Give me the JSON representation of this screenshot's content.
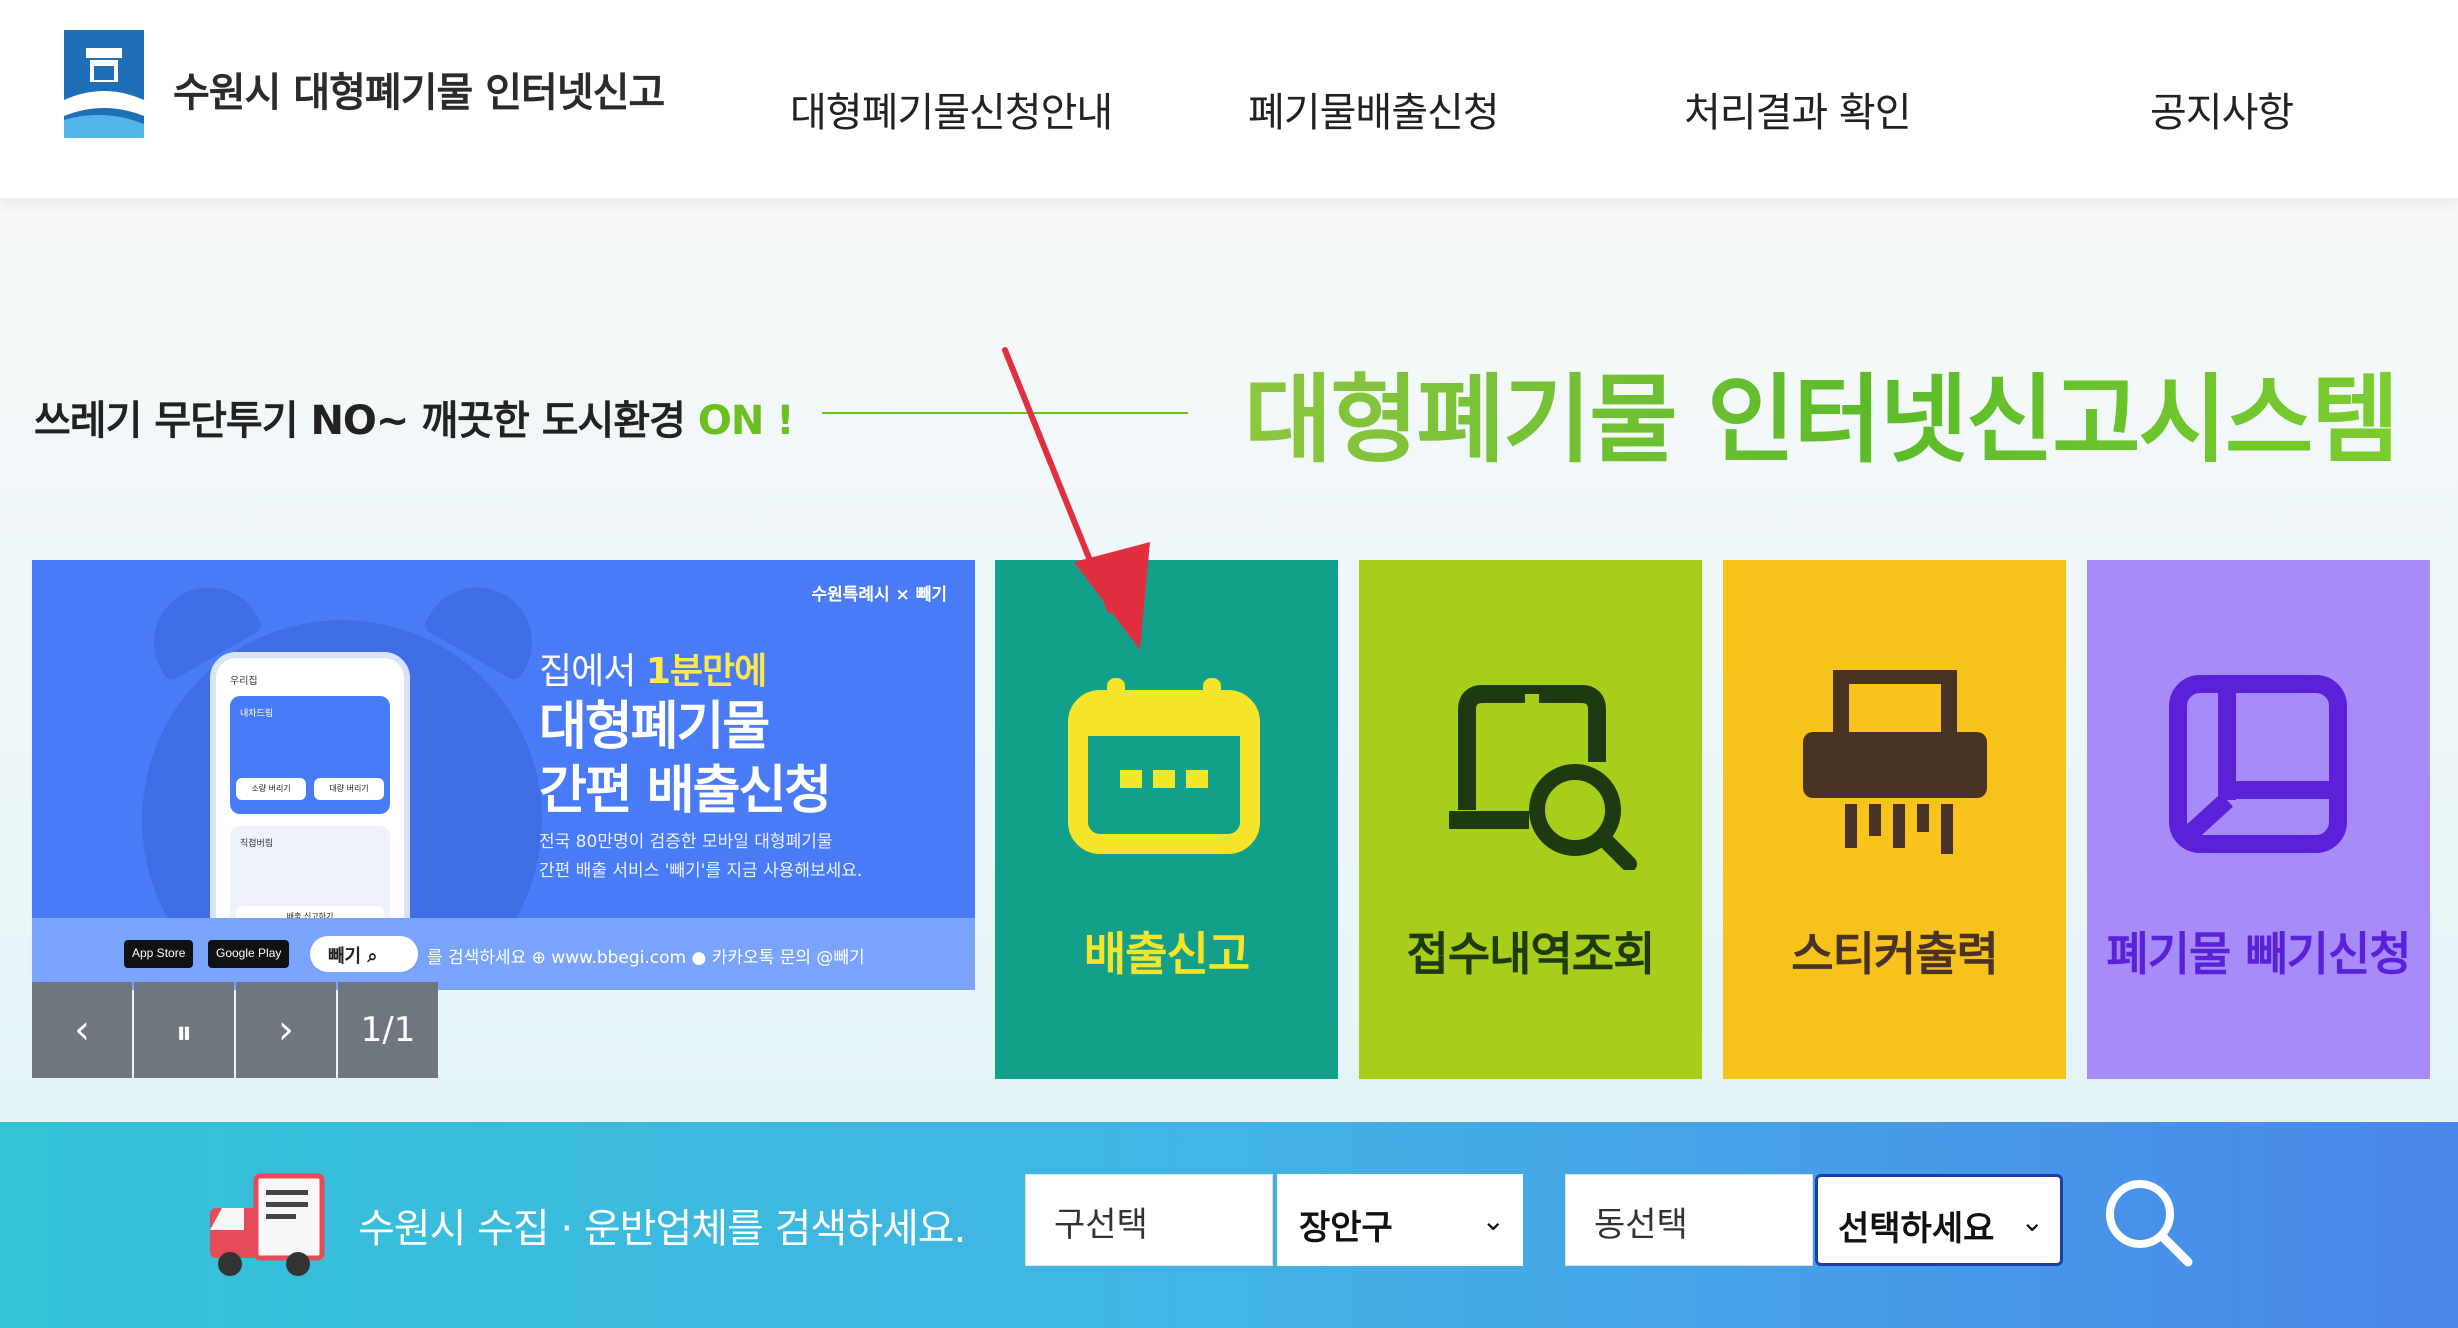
{
  "header": {
    "site_title": "수원시 대형폐기물 인터넷신고",
    "nav": [
      {
        "label": "대형폐기물신청안내"
      },
      {
        "label": "폐기물배출신청"
      },
      {
        "label": "처리결과 확인"
      },
      {
        "label": "공지사항"
      }
    ]
  },
  "hero": {
    "slogan_main": "쓰레기 무단투기 NO~ 깨끗한 도시환경 ",
    "slogan_on": "ON !",
    "big_title": "대형폐기물 인터넷신고시스템"
  },
  "banner": {
    "brand": "수원특례시 × 빼기",
    "sub_pre": "집에서 ",
    "sub_highlight": "1분만에",
    "headline_1": "대형폐기물",
    "headline_2": "간편 배출신청",
    "desc_1": "전국 80만명이 검증한 모바일 대형폐기물",
    "desc_2": "간편 배출 서비스 '빼기'를 지금 사용해보세요.",
    "app_store": "App Store",
    "google_play": "Google Play",
    "search_pill": "빼기",
    "links": "를 검색하세요   ⊕ www.bbegi.com   ● 카카오톡 문의 @빼기",
    "phone_title": "우리집",
    "phone_card1": "내차드림",
    "phone_btn1": "소량 버리기",
    "phone_btn2": "대량 버리기",
    "phone_card2": "직접버림",
    "phone_btn3": "배출 신고하기"
  },
  "slider": {
    "prev": "‹",
    "pause": "⏸",
    "next": "›",
    "counter": "1/1"
  },
  "tiles": [
    {
      "label": "배출신고",
      "bg": "#13a08a",
      "fg": "#f5e52a",
      "icon": "calendar-icon"
    },
    {
      "label": "접수내역조회",
      "bg": "#a8cd1b",
      "fg": "#1e3a10",
      "icon": "search-document-icon"
    },
    {
      "label": "스티커출력",
      "bg": "#f7c21a",
      "fg": "#4a3324",
      "icon": "printer-icon"
    },
    {
      "label": "폐기물 빼기신청",
      "bg": "#a78bf8",
      "fg": "#5a21d9",
      "icon": "layout-icon"
    }
  ],
  "search": {
    "text": "수원시 수집 · 운반업체를 검색하세요.",
    "gu_label": "구선택",
    "gu_value": "장안구",
    "dong_label": "동선택",
    "dong_value": "선택하세요"
  },
  "colors": {
    "accent_green": "#6bbf1f",
    "arrow_red": "#e0303f"
  }
}
